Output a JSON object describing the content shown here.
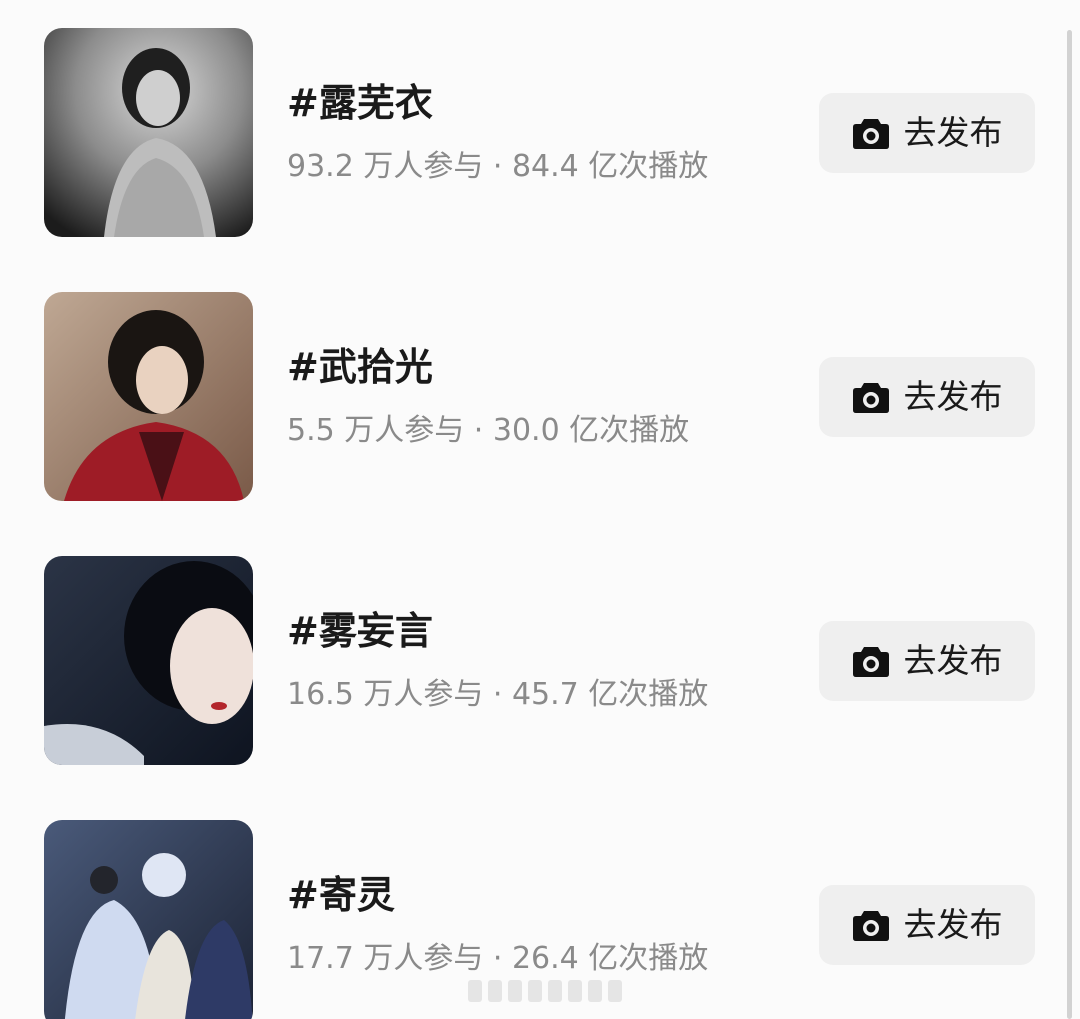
{
  "topics": [
    {
      "title": "#露芜衣",
      "stats": "93.2 万人参与 · 84.4 亿次播放",
      "button_label": "去发布"
    },
    {
      "title": "#武拾光",
      "stats": "5.5 万人参与 · 30.0 亿次播放",
      "button_label": "去发布"
    },
    {
      "title": "#雾妄言",
      "stats": "16.5 万人参与 · 45.7 亿次播放",
      "button_label": "去发布"
    },
    {
      "title": "#寄灵",
      "stats": "17.7 万人参与 · 26.4 亿次播放",
      "button_label": "去发布"
    }
  ],
  "icons": {
    "button_icon": "camera-icon"
  },
  "colors": {
    "background": "#fbfbfb",
    "button_bg": "#efefef",
    "title_text": "#1a1a1a",
    "stats_text": "#8a8a8a"
  }
}
